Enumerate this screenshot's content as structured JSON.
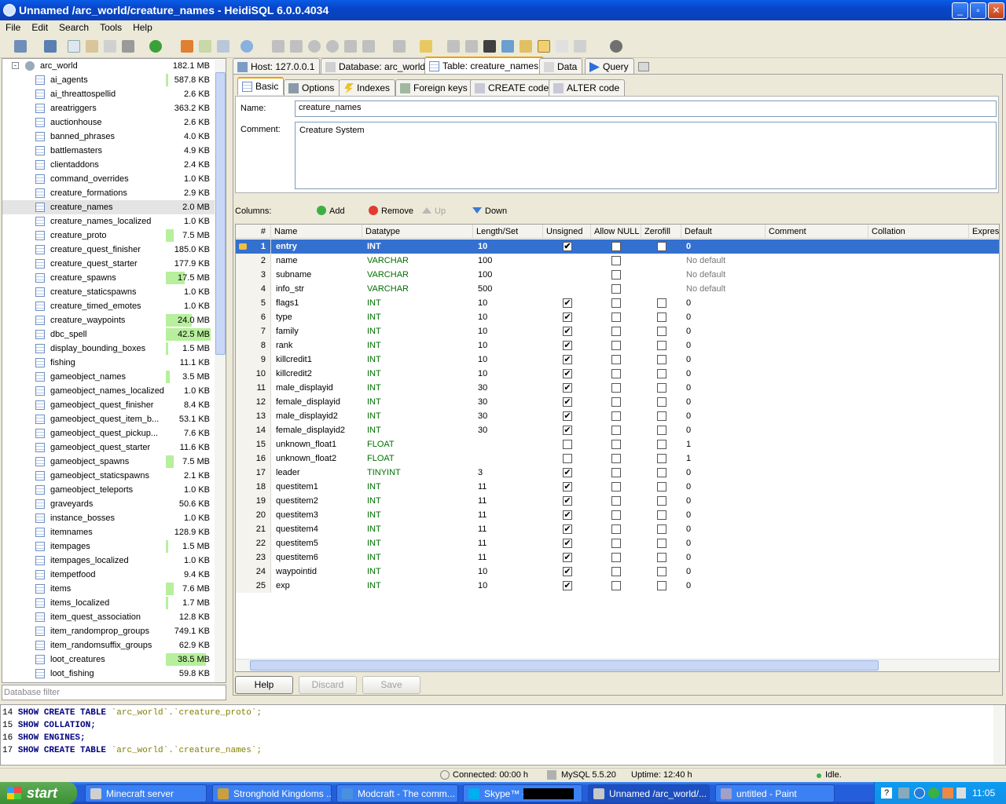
{
  "window": {
    "title": "Unnamed /arc_world/creature_names - HeidiSQL 6.0.0.4034"
  },
  "menu": [
    "File",
    "Edit",
    "Search",
    "Tools",
    "Help"
  ],
  "tree": {
    "db_name": "arc_world",
    "db_size": "182.1 MB",
    "selected": "creature_names",
    "tables": [
      {
        "name": "ai_agents",
        "size": "587.8 KB",
        "bar": 0.05
      },
      {
        "name": "ai_threattospellid",
        "size": "2.6 KB",
        "bar": 0
      },
      {
        "name": "areatriggers",
        "size": "363.2 KB",
        "bar": 0
      },
      {
        "name": "auctionhouse",
        "size": "2.6 KB",
        "bar": 0
      },
      {
        "name": "banned_phrases",
        "size": "4.0 KB",
        "bar": 0
      },
      {
        "name": "battlemasters",
        "size": "4.9 KB",
        "bar": 0
      },
      {
        "name": "clientaddons",
        "size": "2.4 KB",
        "bar": 0
      },
      {
        "name": "command_overrides",
        "size": "1.0 KB",
        "bar": 0
      },
      {
        "name": "creature_formations",
        "size": "2.9 KB",
        "bar": 0
      },
      {
        "name": "creature_names",
        "size": "2.0 MB",
        "bar": 0
      },
      {
        "name": "creature_names_localized",
        "size": "1.0 KB",
        "bar": 0
      },
      {
        "name": "creature_proto",
        "size": "7.5 MB",
        "bar": 0.18
      },
      {
        "name": "creature_quest_finisher",
        "size": "185.0 KB",
        "bar": 0
      },
      {
        "name": "creature_quest_starter",
        "size": "177.9 KB",
        "bar": 0
      },
      {
        "name": "creature_spawns",
        "size": "17.5 MB",
        "bar": 0.42
      },
      {
        "name": "creature_staticspawns",
        "size": "1.0 KB",
        "bar": 0
      },
      {
        "name": "creature_timed_emotes",
        "size": "1.0 KB",
        "bar": 0
      },
      {
        "name": "creature_waypoints",
        "size": "24.0 MB",
        "bar": 0.58
      },
      {
        "name": "dbc_spell",
        "size": "42.5 MB",
        "bar": 1.0
      },
      {
        "name": "display_bounding_boxes",
        "size": "1.5 MB",
        "bar": 0.04
      },
      {
        "name": "fishing",
        "size": "11.1 KB",
        "bar": 0
      },
      {
        "name": "gameobject_names",
        "size": "3.5 MB",
        "bar": 0.08
      },
      {
        "name": "gameobject_names_localized",
        "size": "1.0 KB",
        "bar": 0
      },
      {
        "name": "gameobject_quest_finisher",
        "size": "8.4 KB",
        "bar": 0
      },
      {
        "name": "gameobject_quest_item_b...",
        "size": "53.1 KB",
        "bar": 0
      },
      {
        "name": "gameobject_quest_pickup...",
        "size": "7.6 KB",
        "bar": 0
      },
      {
        "name": "gameobject_quest_starter",
        "size": "11.6 KB",
        "bar": 0
      },
      {
        "name": "gameobject_spawns",
        "size": "7.5 MB",
        "bar": 0.18
      },
      {
        "name": "gameobject_staticspawns",
        "size": "2.1 KB",
        "bar": 0
      },
      {
        "name": "gameobject_teleports",
        "size": "1.0 KB",
        "bar": 0
      },
      {
        "name": "graveyards",
        "size": "50.6 KB",
        "bar": 0
      },
      {
        "name": "instance_bosses",
        "size": "1.0 KB",
        "bar": 0
      },
      {
        "name": "itemnames",
        "size": "128.9 KB",
        "bar": 0
      },
      {
        "name": "itempages",
        "size": "1.5 MB",
        "bar": 0.04
      },
      {
        "name": "itempages_localized",
        "size": "1.0 KB",
        "bar": 0
      },
      {
        "name": "itempetfood",
        "size": "9.4 KB",
        "bar": 0
      },
      {
        "name": "items",
        "size": "7.6 MB",
        "bar": 0.18
      },
      {
        "name": "items_localized",
        "size": "1.7 MB",
        "bar": 0.04
      },
      {
        "name": "item_quest_association",
        "size": "12.8 KB",
        "bar": 0
      },
      {
        "name": "item_randomprop_groups",
        "size": "749.1 KB",
        "bar": 0
      },
      {
        "name": "item_randomsuffix_groups",
        "size": "62.9 KB",
        "bar": 0
      },
      {
        "name": "loot_creatures",
        "size": "38.5 MB",
        "bar": 0.9
      },
      {
        "name": "loot_fishing",
        "size": "59.8 KB",
        "bar": 0
      }
    ],
    "filter_placeholder": "Database filter"
  },
  "tabs": {
    "host": "Host: 127.0.0.1",
    "database": "Database: arc_world",
    "table": "Table: creature_names",
    "data": "Data",
    "query": "Query"
  },
  "subtabs": {
    "basic": "Basic",
    "options": "Options",
    "indexes": "Indexes",
    "foreign_keys": "Foreign keys",
    "create_code": "CREATE code",
    "alter_code": "ALTER code"
  },
  "basic": {
    "name_label": "Name:",
    "name_value": "creature_names",
    "comment_label": "Comment:",
    "comment_value": "Creature System"
  },
  "columns_toolbar": {
    "label": "Columns:",
    "add": "Add",
    "remove": "Remove",
    "up": "Up",
    "down": "Down"
  },
  "grid": {
    "headers": [
      "#",
      "Name",
      "Datatype",
      "Length/Set",
      "Unsigned",
      "Allow NULL",
      "Zerofill",
      "Default",
      "Comment",
      "Collation",
      "Expres"
    ],
    "rows": [
      {
        "n": "1",
        "name": "entry",
        "type": "INT",
        "len": "10",
        "unsigned": true,
        "allow_null": false,
        "zerofill": false,
        "zf_show": true,
        "def": "0"
      },
      {
        "n": "2",
        "name": "name",
        "type": "VARCHAR",
        "len": "100",
        "unsigned": false,
        "un_show": false,
        "allow_null": false,
        "zf_show": false,
        "def": "No default"
      },
      {
        "n": "3",
        "name": "subname",
        "type": "VARCHAR",
        "len": "100",
        "un_show": false,
        "allow_null": false,
        "zf_show": false,
        "def": "No default"
      },
      {
        "n": "4",
        "name": "info_str",
        "type": "VARCHAR",
        "len": "500",
        "un_show": false,
        "allow_null": false,
        "zf_show": false,
        "def": "No default"
      },
      {
        "n": "5",
        "name": "flags1",
        "type": "INT",
        "len": "10",
        "unsigned": true,
        "allow_null": false,
        "zerofill": false,
        "zf_show": true,
        "def": "0"
      },
      {
        "n": "6",
        "name": "type",
        "type": "INT",
        "len": "10",
        "unsigned": true,
        "allow_null": false,
        "zerofill": false,
        "zf_show": true,
        "def": "0"
      },
      {
        "n": "7",
        "name": "family",
        "type": "INT",
        "len": "10",
        "unsigned": true,
        "allow_null": false,
        "zerofill": false,
        "zf_show": true,
        "def": "0"
      },
      {
        "n": "8",
        "name": "rank",
        "type": "INT",
        "len": "10",
        "unsigned": true,
        "allow_null": false,
        "zerofill": false,
        "zf_show": true,
        "def": "0"
      },
      {
        "n": "9",
        "name": "killcredit1",
        "type": "INT",
        "len": "10",
        "unsigned": true,
        "allow_null": false,
        "zerofill": false,
        "zf_show": true,
        "def": "0"
      },
      {
        "n": "10",
        "name": "killcredit2",
        "type": "INT",
        "len": "10",
        "unsigned": true,
        "allow_null": false,
        "zerofill": false,
        "zf_show": true,
        "def": "0"
      },
      {
        "n": "11",
        "name": "male_displayid",
        "type": "INT",
        "len": "30",
        "unsigned": true,
        "allow_null": false,
        "zerofill": false,
        "zf_show": true,
        "def": "0"
      },
      {
        "n": "12",
        "name": "female_displayid",
        "type": "INT",
        "len": "30",
        "unsigned": true,
        "allow_null": false,
        "zerofill": false,
        "zf_show": true,
        "def": "0"
      },
      {
        "n": "13",
        "name": "male_displayid2",
        "type": "INT",
        "len": "30",
        "unsigned": true,
        "allow_null": false,
        "zerofill": false,
        "zf_show": true,
        "def": "0"
      },
      {
        "n": "14",
        "name": "female_displayid2",
        "type": "INT",
        "len": "30",
        "unsigned": true,
        "allow_null": false,
        "zerofill": false,
        "zf_show": true,
        "def": "0"
      },
      {
        "n": "15",
        "name": "unknown_float1",
        "type": "FLOAT",
        "len": "",
        "unsigned": false,
        "allow_null": false,
        "zerofill": false,
        "zf_show": true,
        "def": "1"
      },
      {
        "n": "16",
        "name": "unknown_float2",
        "type": "FLOAT",
        "len": "",
        "unsigned": false,
        "allow_null": false,
        "zerofill": false,
        "zf_show": true,
        "def": "1"
      },
      {
        "n": "17",
        "name": "leader",
        "type": "TINYINT",
        "len": "3",
        "unsigned": true,
        "allow_null": false,
        "zerofill": false,
        "zf_show": true,
        "def": "0"
      },
      {
        "n": "18",
        "name": "questitem1",
        "type": "INT",
        "len": "11",
        "unsigned": true,
        "allow_null": false,
        "zerofill": false,
        "zf_show": true,
        "def": "0"
      },
      {
        "n": "19",
        "name": "questitem2",
        "type": "INT",
        "len": "11",
        "unsigned": true,
        "allow_null": false,
        "zerofill": false,
        "zf_show": true,
        "def": "0"
      },
      {
        "n": "20",
        "name": "questitem3",
        "type": "INT",
        "len": "11",
        "unsigned": true,
        "allow_null": false,
        "zerofill": false,
        "zf_show": true,
        "def": "0"
      },
      {
        "n": "21",
        "name": "questitem4",
        "type": "INT",
        "len": "11",
        "unsigned": true,
        "allow_null": false,
        "zerofill": false,
        "zf_show": true,
        "def": "0"
      },
      {
        "n": "22",
        "name": "questitem5",
        "type": "INT",
        "len": "11",
        "unsigned": true,
        "allow_null": false,
        "zerofill": false,
        "zf_show": true,
        "def": "0"
      },
      {
        "n": "23",
        "name": "questitem6",
        "type": "INT",
        "len": "11",
        "unsigned": true,
        "allow_null": false,
        "zerofill": false,
        "zf_show": true,
        "def": "0"
      },
      {
        "n": "24",
        "name": "waypointid",
        "type": "INT",
        "len": "10",
        "unsigned": true,
        "allow_null": false,
        "zerofill": false,
        "zf_show": true,
        "def": "0"
      },
      {
        "n": "25",
        "name": "exp",
        "type": "INT",
        "len": "10",
        "unsigned": true,
        "allow_null": false,
        "zerofill": false,
        "zf_show": true,
        "def": "0"
      }
    ]
  },
  "buttons": {
    "help": "Help",
    "discard": "Discard",
    "save": "Save"
  },
  "sql_log": [
    {
      "n": "14",
      "kw": "SHOW CREATE TABLE",
      "rest": "`arc_world`.`creature_proto`;"
    },
    {
      "n": "15",
      "kw": "SHOW COLLATION;",
      "rest": ""
    },
    {
      "n": "16",
      "kw": "SHOW ENGINES;",
      "rest": ""
    },
    {
      "n": "17",
      "kw": "SHOW CREATE TABLE",
      "rest": "`arc_world`.`creature_names`;"
    }
  ],
  "status": {
    "connected": "Connected: 00:00 h",
    "server": "MySQL 5.5.20",
    "uptime": "Uptime: 12:40 h",
    "state": "Idle."
  },
  "taskbar": {
    "start": "start",
    "tasks": [
      "Minecraft server",
      "Stronghold Kingdoms ...",
      "Modcraft - The comm...",
      "Skype™ -",
      "Unnamed /arc_world/...",
      "untitled - Paint"
    ],
    "clock": "11:05 PM"
  },
  "colors": {
    "accent": "#3470d0",
    "size_bar": "#b7ef9c",
    "datatype": "#007000"
  }
}
